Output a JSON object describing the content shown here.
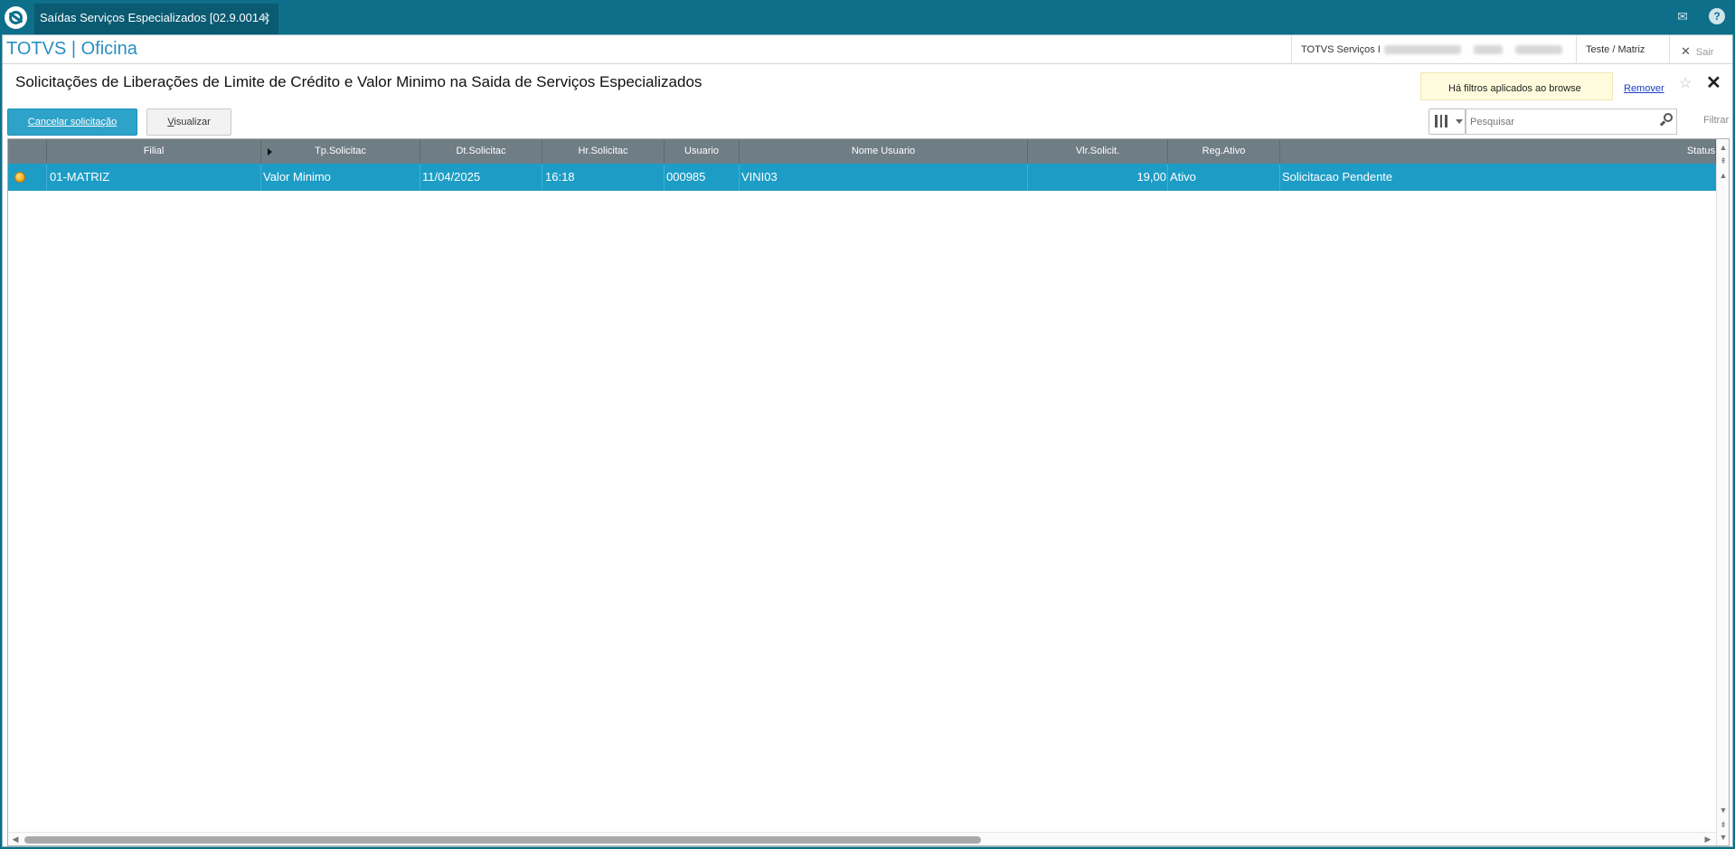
{
  "tab": {
    "title": "Saídas Serviços Especializados [02.9.0014]",
    "close": "✕"
  },
  "top_icons": {
    "mail": "✉",
    "help": "?"
  },
  "appbar": {
    "brand": "TOTVS | Oficina",
    "company": "TOTVS Serviços I",
    "branch": "Teste / Matriz",
    "exit_label": "Sair",
    "exit_icon": "✕"
  },
  "page": {
    "title": "Solicitações de Liberações de Limite de Crédito e Valor Minimo na Saida de Serviços Especializados",
    "filter_notice": "Há filtros aplicados ao browse",
    "filter_remove": "Remover",
    "star": "☆",
    "close": "✕"
  },
  "toolbar": {
    "cancel_label_u": "C",
    "cancel_label_rest": "ancelar solicitação",
    "view_label_u": "V",
    "view_label_rest": "isualizar",
    "search_placeholder": "Pesquisar",
    "filter_label": "Filtrar"
  },
  "grid": {
    "columns": [
      "",
      "Filial",
      "Tp.Solicitac",
      "Dt.Solicitac",
      "Hr.Solicitac",
      "Usuario",
      "Nome Usuario",
      "Vlr.Solicit.",
      "Reg.Ativo",
      "Status"
    ],
    "rows": [
      {
        "status_color": "#f0a417",
        "filial": "01-MATRIZ",
        "tp_solicitac": "Valor Minimo",
        "dt_solicitac": "11/04/2025",
        "hr_solicitac": "16:18",
        "usuario": "000985",
        "nome_usuario": "VINI03",
        "vlr_solicit": "19,00",
        "reg_ativo": "Ativo",
        "status": "Solicitacao Pendente"
      }
    ]
  },
  "scrollbar": {
    "up": "▲",
    "top": "⇞",
    "down": "▼",
    "bottom": "⇟",
    "left": "◀",
    "right": "▶"
  }
}
